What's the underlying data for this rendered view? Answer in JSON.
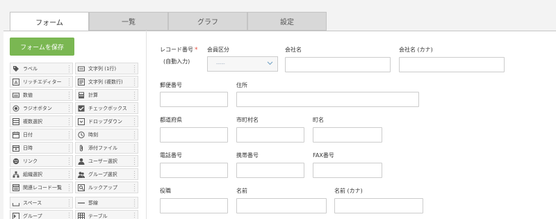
{
  "tabs": {
    "form": "フォーム",
    "list": "一覧",
    "graph": "グラフ",
    "settings": "設定"
  },
  "palette": {
    "save_label": "フォームを保存",
    "items": [
      {
        "label": "ラベル",
        "icon": "tag-icon"
      },
      {
        "label": "文字列 (1行)",
        "icon": "single-line-text-icon"
      },
      {
        "label": "リッチエディター",
        "icon": "rich-editor-icon"
      },
      {
        "label": "文字列 (複数行)",
        "icon": "multi-line-text-icon"
      },
      {
        "label": "数値",
        "icon": "number-icon"
      },
      {
        "label": "計算",
        "icon": "calculator-icon"
      },
      {
        "label": "ラジオボタン",
        "icon": "radio-icon"
      },
      {
        "label": "チェックボックス",
        "icon": "checkbox-icon"
      },
      {
        "label": "複数選択",
        "icon": "multi-select-icon"
      },
      {
        "label": "ドロップダウン",
        "icon": "dropdown-icon"
      },
      {
        "label": "日付",
        "icon": "calendar-icon"
      },
      {
        "label": "時刻",
        "icon": "clock-icon"
      },
      {
        "label": "日時",
        "icon": "datetime-icon"
      },
      {
        "label": "添付ファイル",
        "icon": "paperclip-icon"
      },
      {
        "label": "リンク",
        "icon": "globe-icon"
      },
      {
        "label": "ユーザー選択",
        "icon": "user-icon"
      },
      {
        "label": "組織選択",
        "icon": "org-icon"
      },
      {
        "label": "グループ選択",
        "icon": "group-icon"
      },
      {
        "label": "関連レコード一覧",
        "icon": "related-records-icon"
      },
      {
        "label": "ルックアップ",
        "icon": "lookup-icon"
      },
      {
        "label": "スペース",
        "icon": "space-icon"
      },
      {
        "label": "罫線",
        "icon": "border-line-icon"
      },
      {
        "label": "グループ",
        "icon": "group-field-icon"
      },
      {
        "label": "テーブル",
        "icon": "table-icon"
      }
    ]
  },
  "form": {
    "record_number": {
      "label": "レコード番号",
      "required_mark": "*",
      "sub": "(自動入力)"
    },
    "member_type": {
      "label": "会員区分",
      "select_value": "-----"
    },
    "company_name": {
      "label": "会社名",
      "value": ""
    },
    "company_kana": {
      "label": "会社名 (カナ)",
      "value": ""
    },
    "postal_code": {
      "label": "郵便番号",
      "value": ""
    },
    "address": {
      "label": "住所",
      "value": ""
    },
    "prefecture": {
      "label": "都道府県",
      "value": ""
    },
    "city": {
      "label": "市町村名",
      "value": ""
    },
    "town": {
      "label": "町名",
      "value": ""
    },
    "phone": {
      "label": "電話番号",
      "value": ""
    },
    "mobile": {
      "label": "携帯番号",
      "value": ""
    },
    "fax": {
      "label": "FAX番号",
      "value": ""
    },
    "title": {
      "label": "役職",
      "value": ""
    },
    "name": {
      "label": "名前",
      "value": ""
    },
    "name_kana": {
      "label": "名前 (カナ)",
      "value": ""
    }
  },
  "colors": {
    "save_button": "#7ab752",
    "required": "#e74c3c"
  }
}
